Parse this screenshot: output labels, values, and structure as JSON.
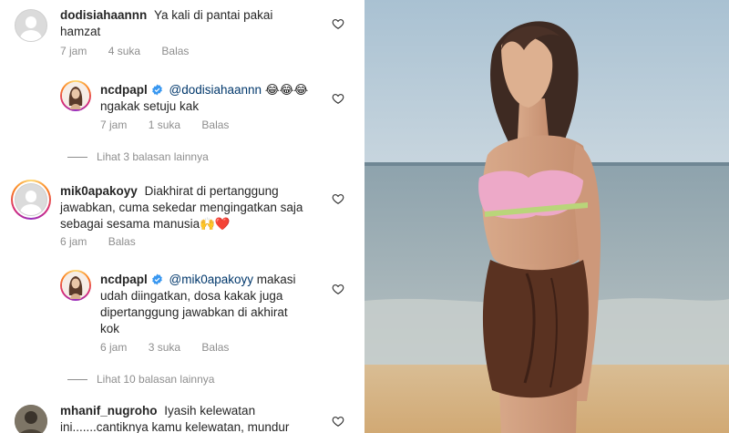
{
  "comments": [
    {
      "username": "dodisiahaannn",
      "text_line1": "Ya kali di pantai pakai",
      "text_line2": "hamzat",
      "time": "7 jam",
      "likes": "4 suka",
      "reply": "Balas"
    },
    {
      "username": "ncdpapl",
      "mention": "@dodisiahaannn",
      "emoji": "😂😂😂",
      "text_line2": "ngakak setuju kak",
      "time": "7 jam",
      "likes": "1 suka",
      "reply": "Balas"
    },
    {
      "more_replies": "Lihat 3 balasan lainnya"
    },
    {
      "username": "mik0apakoyy",
      "text_line1": "Diakhirat di pertanggung",
      "text_line2": "jawabkan, cuma sekedar mengingatkan saja",
      "text_line3": "sebagai sesama manusia🙌❤️",
      "time": "6 jam",
      "reply": "Balas"
    },
    {
      "username": "ncdpapl",
      "mention": "@mik0apakoyy",
      "text_line1": "makasi",
      "text_line2": "udah diingatkan, dosa kakak juga",
      "text_line3": "dipertanggung jawabkan di akhirat",
      "text_line4": "kok",
      "time": "6 jam",
      "likes": "3 suka",
      "reply": "Balas"
    },
    {
      "more_replies": "Lihat 10 balasan lainnya"
    },
    {
      "username": "mhanif_nugroho",
      "text_line1": "Iyasih kelewatan",
      "text_line2": "ini.......cantiknya kamu kelewatan, mundur"
    }
  ],
  "colors": {
    "text": "#262626",
    "secondary": "#8e8e8e",
    "mention": "#00376b",
    "verified": "#3897f0"
  },
  "icons": {
    "like": "heart-outline-icon",
    "verified": "verified-badge-icon"
  }
}
